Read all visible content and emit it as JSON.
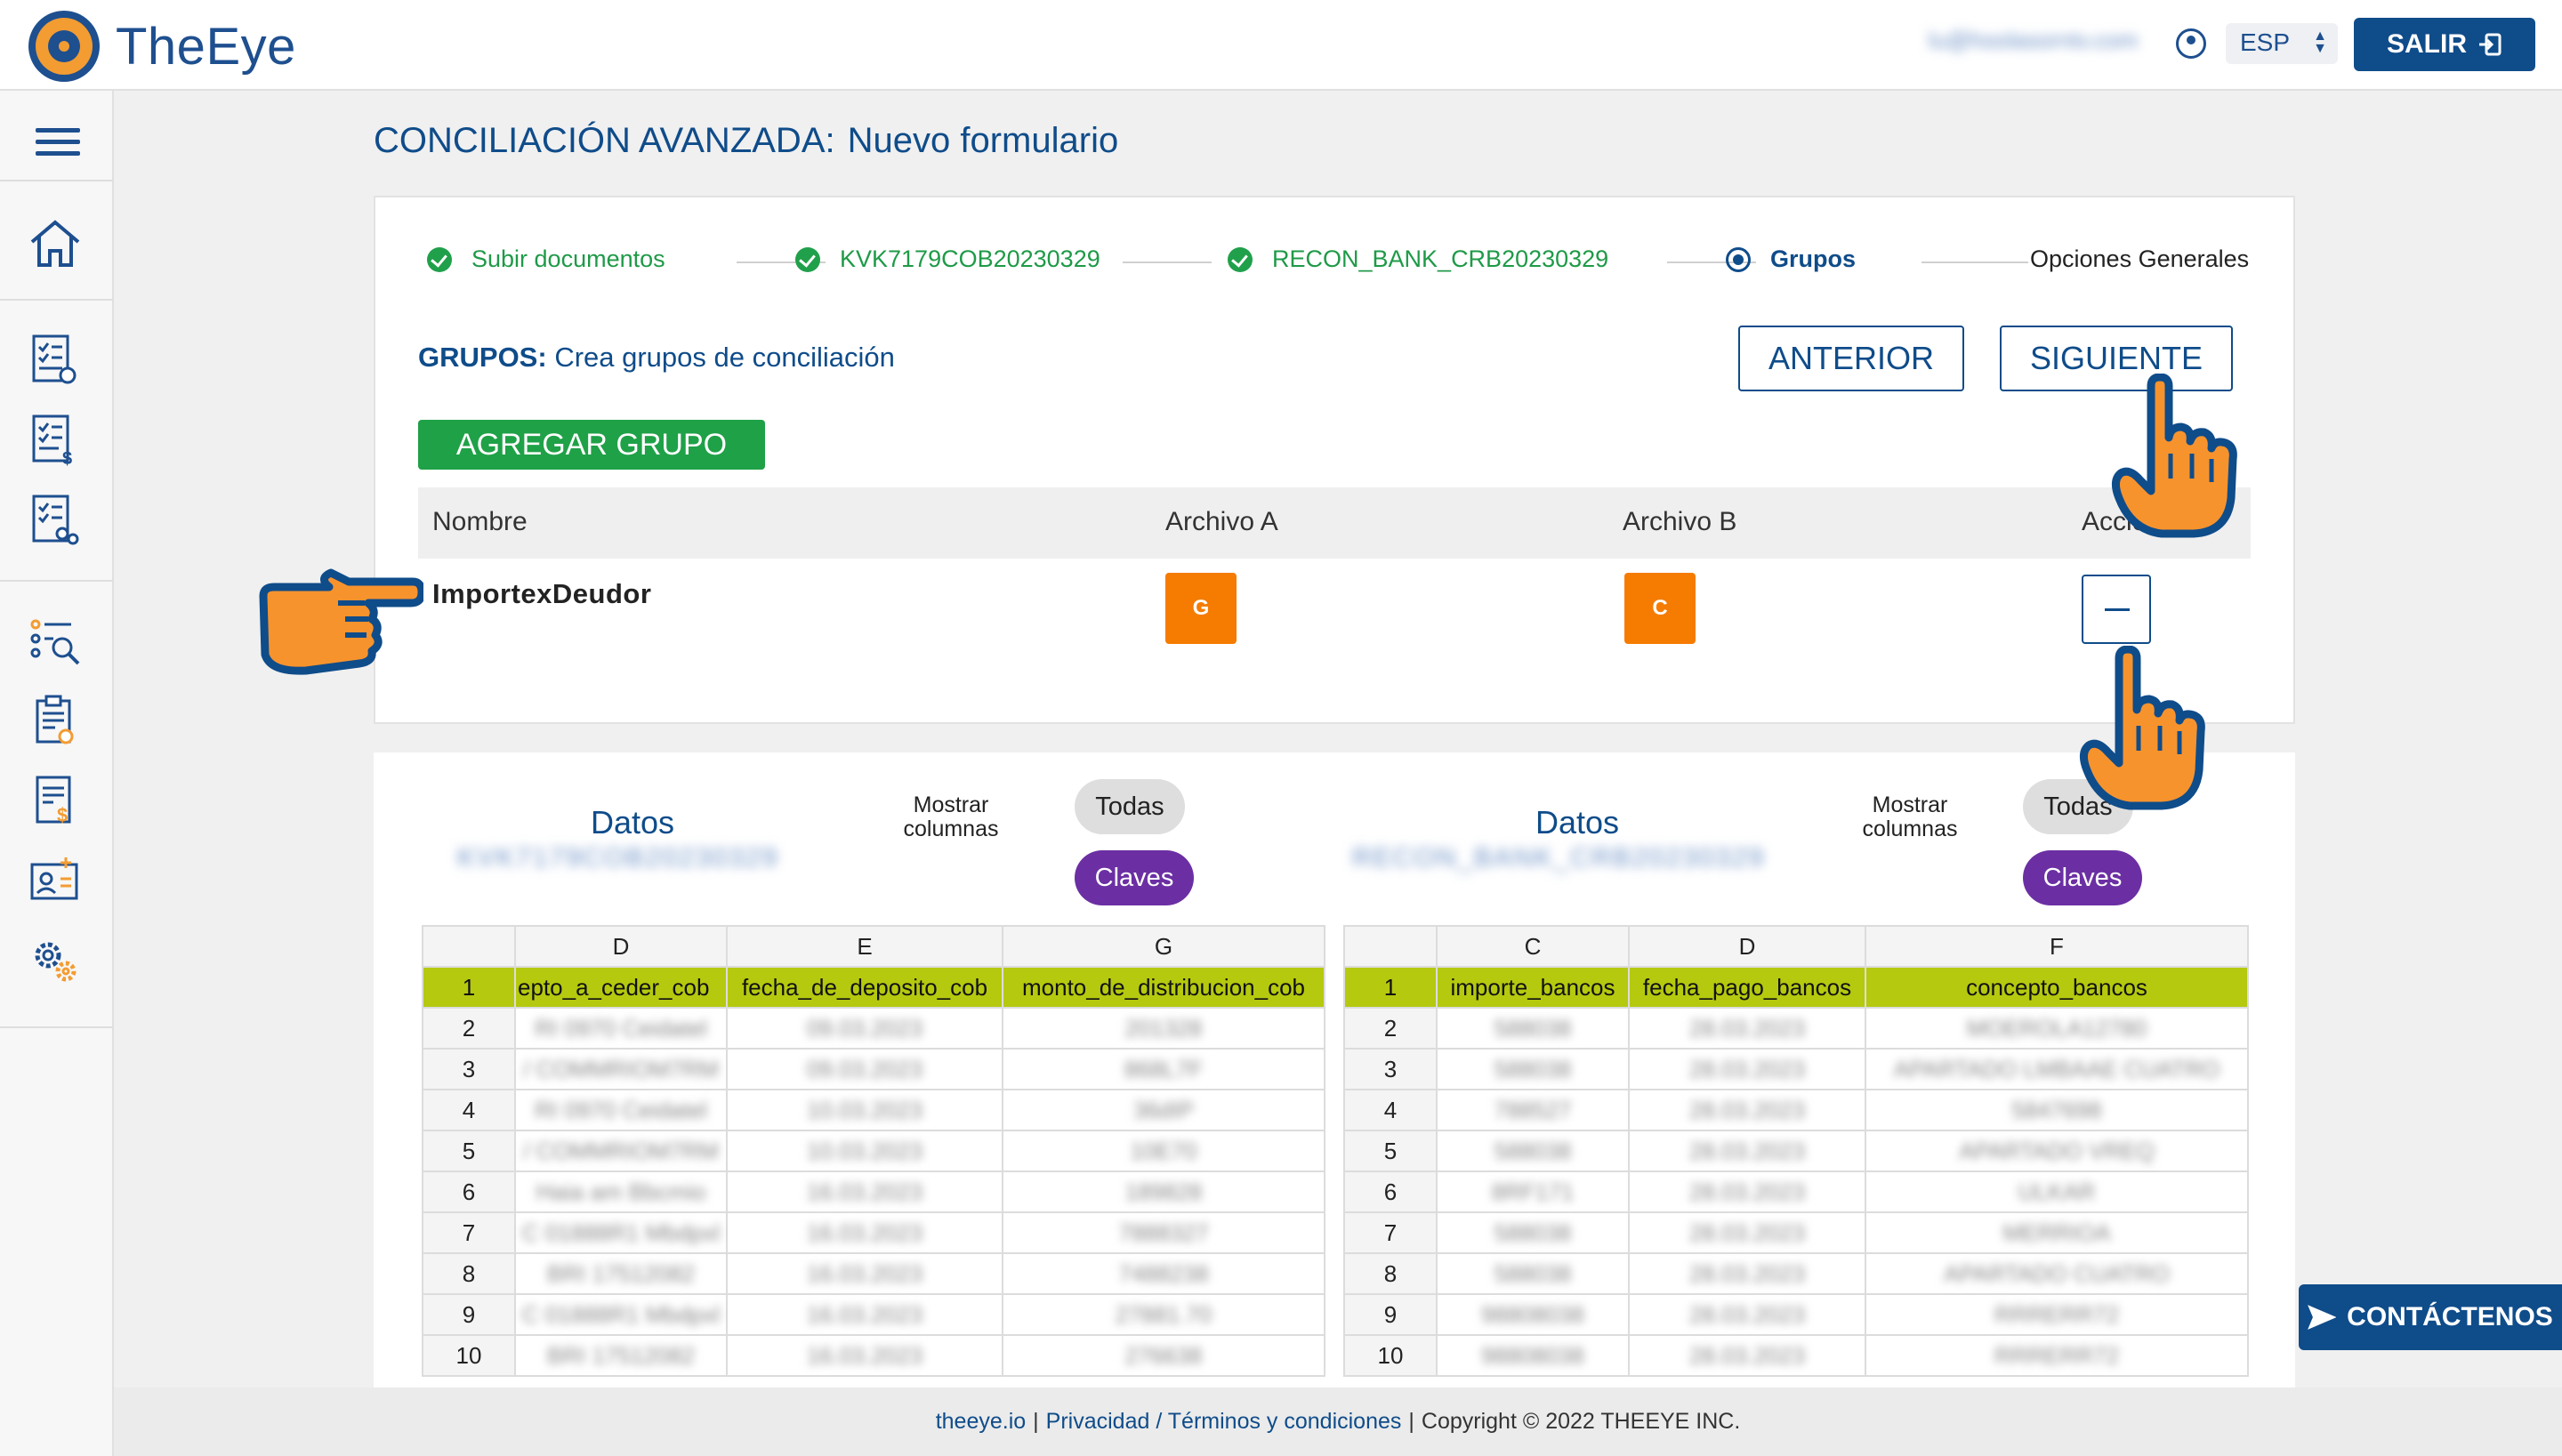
{
  "app": {
    "name": "TheEye"
  },
  "header": {
    "user_email": "lu@hoolasorntv.com",
    "language": "ESP",
    "exit_label": "SALIR"
  },
  "page": {
    "title": "CONCILIACIÓN AVANZADA:",
    "subtitle": "Nuevo formulario"
  },
  "stepper": {
    "steps": [
      {
        "label": "Subir documentos",
        "state": "done"
      },
      {
        "label": "KVK7179COB20230329",
        "state": "done"
      },
      {
        "label": "RECON_BANK_CRB20230329",
        "state": "done"
      },
      {
        "label": "Grupos",
        "state": "active"
      },
      {
        "label": "Opciones Generales",
        "state": "pending"
      }
    ]
  },
  "groups": {
    "label_bold": "GRUPOS:",
    "label_rest": "Crea grupos de conciliación",
    "prev_label": "ANTERIOR",
    "next_label": "SIGUIENTE",
    "add_label": "AGREGAR GRUPO",
    "columns": [
      "Nombre",
      "Archivo A",
      "Archivo B",
      "Acciones"
    ],
    "rows": [
      {
        "name": "ImportexDeudor",
        "file_a": "G",
        "file_b": "C"
      }
    ]
  },
  "data_left": {
    "title": "Datos",
    "file_name": "KVK7179COB20230329",
    "show_columns": "Mostrar columnas",
    "all_label": "Todas",
    "keys_label": "Claves",
    "col_letters": [
      "D",
      "E",
      "G"
    ],
    "header_row": [
      "epto_a_ceder_cob",
      "fecha_de_deposito_cob",
      "monto_de_distribucion_cob"
    ],
    "rows": [
      [
        "1",
        "",
        "",
        ""
      ],
      [
        "2",
        "RI 0970 Ceidatel",
        "09.03.2023",
        "201328"
      ],
      [
        "3",
        "/ COMMRIOM7RM",
        "09.03.2023",
        "868L7F"
      ],
      [
        "4",
        "RI 0970 Ceidatel",
        "10.03.2023",
        "36dIP"
      ],
      [
        "5",
        "/ COMMRIOM7RM",
        "10.03.2023",
        "10E70"
      ],
      [
        "6",
        "Haia am Bbcmio",
        "16.03.2023",
        "189828"
      ],
      [
        "7",
        "C 01888R1 Mbdpxl",
        "16.03.2023",
        "7888327"
      ],
      [
        "8",
        "BRI 17512082",
        "16.03.2023",
        "7488238"
      ],
      [
        "9",
        "C 01888R1 Mbdpxl",
        "16.03.2023",
        "27881.70"
      ],
      [
        "10",
        "BRI 17512082",
        "16.03.2023",
        "276638"
      ]
    ]
  },
  "data_right": {
    "title": "Datos",
    "file_name": "RECON_BANK_CRB20230329",
    "show_columns": "Mostrar columnas",
    "all_label": "Todas",
    "keys_label": "Claves",
    "col_letters": [
      "C",
      "D",
      "F"
    ],
    "header_row": [
      "importe_bancos",
      "fecha_pago_bancos",
      "concepto_bancos"
    ],
    "rows": [
      [
        "1",
        "",
        "",
        ""
      ],
      [
        "2",
        "588038",
        "28.03.2023",
        "MOEROLA12780"
      ],
      [
        "3",
        "588038",
        "28.03.2023",
        "APARTADO LMBAAE CUATRO"
      ],
      [
        "4",
        "788527",
        "28.03.2023",
        "5847698"
      ],
      [
        "5",
        "588038",
        "28.03.2023",
        "APARTADO VREQ"
      ],
      [
        "6",
        "8RF171",
        "28.03.2023",
        "ULKAR"
      ],
      [
        "7",
        "588038",
        "28.03.2023",
        "MERRIOA"
      ],
      [
        "8",
        "588038",
        "28.03.2023",
        "APARTADO CUATRO"
      ],
      [
        "9",
        "98808038",
        "28.03.2023",
        "RRRERR72"
      ],
      [
        "10",
        "98808038",
        "28.03.2023",
        "RRRERR72"
      ]
    ]
  },
  "footer": {
    "site": "theeye.io",
    "privacy": "Privacidad / Términos y condiciones",
    "copyright": "Copyright © 2022 THEEYE INC.",
    "sep": "|"
  },
  "contact_label": "CONTÁCTENOS",
  "colors": {
    "brand": "#0f4c8a",
    "accent_orange": "#f57c00",
    "success": "#1fa147",
    "keys_purple": "#6b2fa3",
    "header_row": "#b5c90f"
  }
}
